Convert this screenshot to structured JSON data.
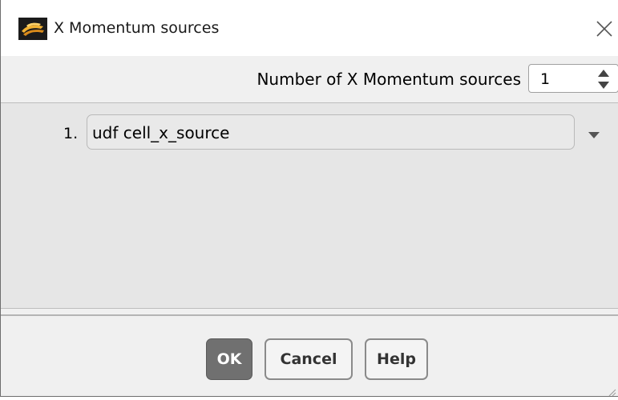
{
  "window": {
    "title": "X Momentum sources",
    "app_icon": "fluent-app-icon",
    "close_icon": "close-icon"
  },
  "count": {
    "label": "Number of X Momentum sources",
    "value": "1",
    "spinner_icon": "spinner-arrows-icon"
  },
  "sources": {
    "items": [
      {
        "index": "1.",
        "value": "udf cell_x_source"
      }
    ],
    "dropdown_icon": "chevron-down-icon"
  },
  "buttons": {
    "ok": "OK",
    "cancel": "Cancel",
    "help": "Help"
  },
  "colors": {
    "dialog_bg": "#f0f0f0",
    "panel_bg": "#e6e6e6",
    "ok_bg": "#707070",
    "title_bg": "#ffffff"
  }
}
